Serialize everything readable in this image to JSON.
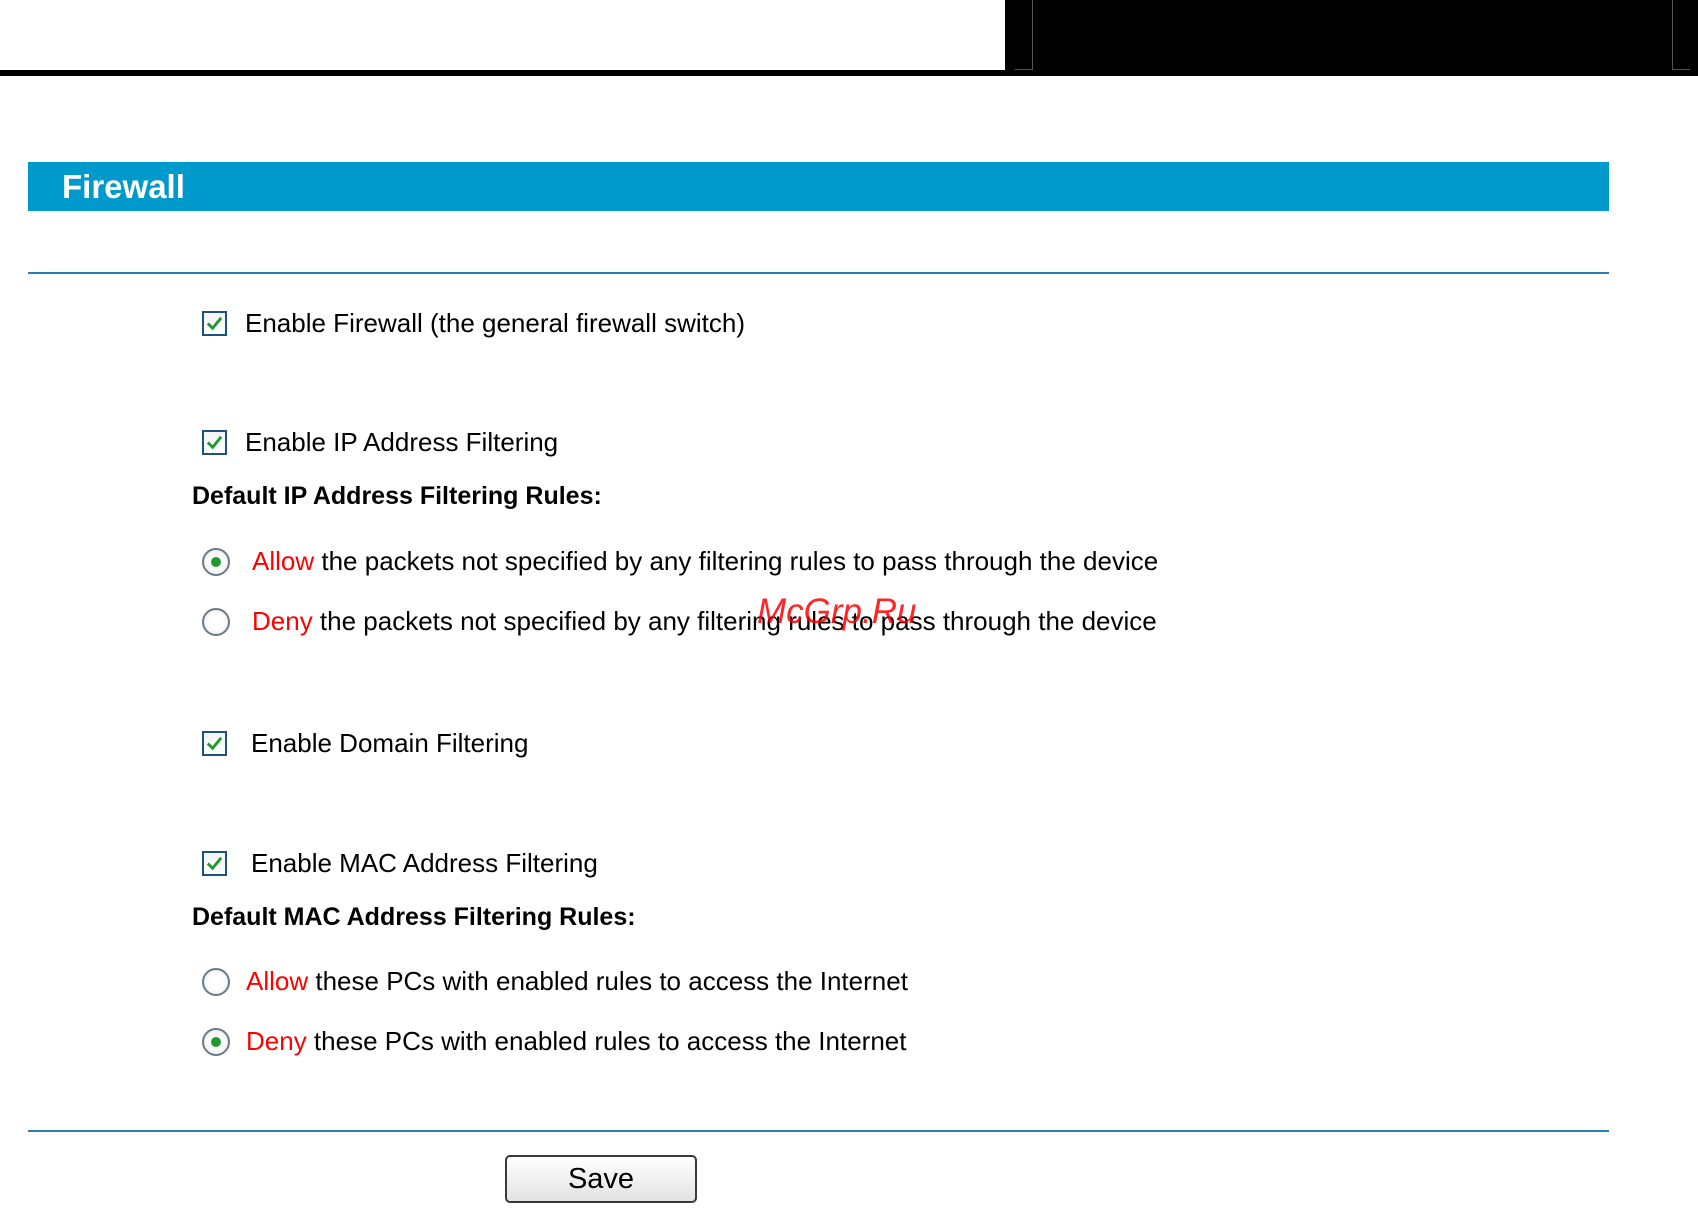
{
  "page": {
    "title": "Firewall",
    "watermark": "McGrp.Ru"
  },
  "firewall": {
    "enable_label": "Enable Firewall (the general firewall switch)",
    "enabled": true
  },
  "ip_filtering": {
    "enable_label": "Enable IP Address Filtering",
    "enabled": true,
    "rules_header": "Default IP Address Filtering Rules:",
    "options": [
      {
        "keyword": "Allow",
        "text": " the packets not specified by any filtering rules to pass through the device",
        "selected": true
      },
      {
        "keyword": "Deny",
        "text": " the packets not specified by any filtering rules to pass through the device",
        "selected": false
      }
    ]
  },
  "domain_filtering": {
    "enable_label": "Enable Domain Filtering",
    "enabled": true
  },
  "mac_filtering": {
    "enable_label": "Enable MAC Address Filtering",
    "enabled": true,
    "rules_header": "Default MAC Address Filtering Rules:",
    "options": [
      {
        "keyword": "Allow",
        "text": " these PCs with enabled rules to access the Internet",
        "selected": false
      },
      {
        "keyword": "Deny",
        "text": " these PCs with enabled rules to access the Internet",
        "selected": true
      }
    ]
  },
  "actions": {
    "save_label": "Save"
  },
  "colors": {
    "title_bar": "#0099cc",
    "keyword": "#ff0000",
    "check": "#1e9a2f",
    "rule": "#2a7fb0"
  }
}
